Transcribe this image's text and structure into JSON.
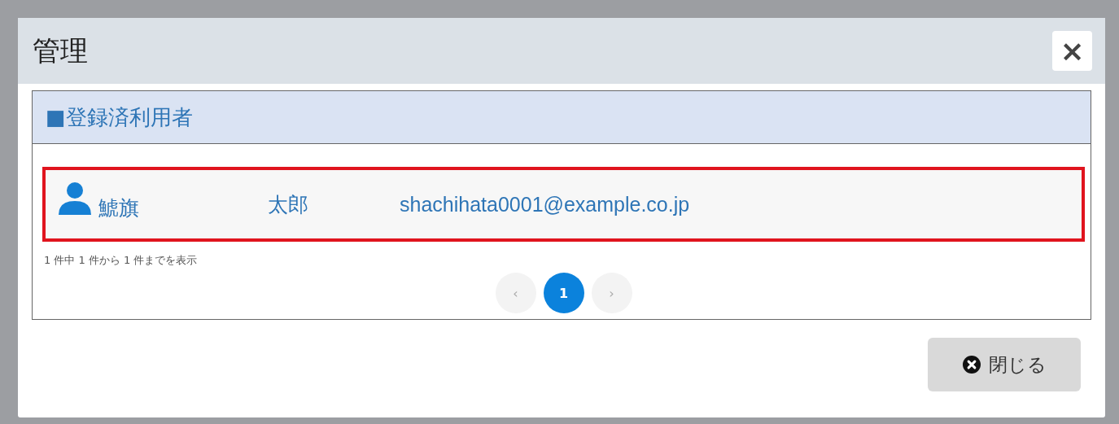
{
  "dialog": {
    "title": "管理",
    "close_label": "×"
  },
  "section": {
    "title": "■登録済利用者"
  },
  "users": [
    {
      "last_name": "鯱旗",
      "first_name": "太郎",
      "email": "shachihata0001@example.co.jp",
      "highlighted": true
    }
  ],
  "info": "1 件中 1 件から 1 件までを表示",
  "pagination": {
    "prev": {
      "label": "‹",
      "disabled": true
    },
    "pages": [
      {
        "label": "1",
        "selected": true
      }
    ],
    "next": {
      "label": "›",
      "disabled": true
    }
  },
  "buttons": [
    {
      "label": "閉じる"
    }
  ]
}
